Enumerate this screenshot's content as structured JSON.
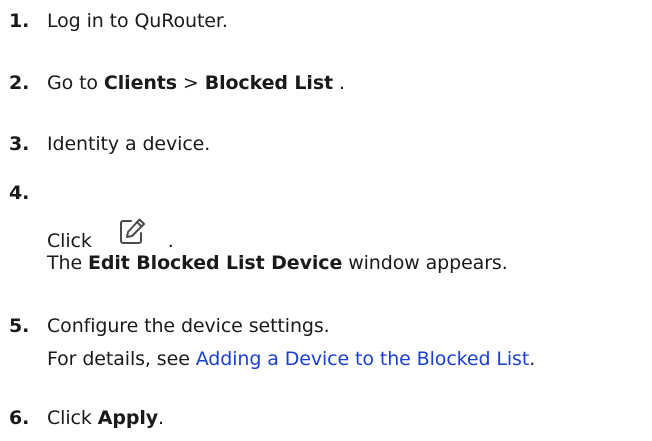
{
  "steps": [
    {
      "num": "1.",
      "text": "Log in to QuRouter."
    },
    {
      "num": "2.",
      "prefix": "Go to ",
      "bold1": "Clients",
      "sep": " > ",
      "bold2": "Blocked List",
      "suffix": " ."
    },
    {
      "num": "3.",
      "text": "Identity a device."
    },
    {
      "num": "4.",
      "click_prefix": "Click ",
      "click_suffix": ".",
      "result_prefix": "The ",
      "result_bold": "Edit Blocked List Device",
      "result_suffix": " window appears.",
      "icon": "edit-icon"
    },
    {
      "num": "5.",
      "text": "Configure the device settings.",
      "detail_prefix": "For details, see ",
      "link_text": "Adding a Device to the Blocked List",
      "detail_suffix": "."
    },
    {
      "num": "6.",
      "prefix": "Click ",
      "bold": "Apply",
      "suffix": "."
    }
  ],
  "colors": {
    "text": "#1a1a1a",
    "link": "#1a3fd6",
    "icon": "#4a4a4a"
  }
}
